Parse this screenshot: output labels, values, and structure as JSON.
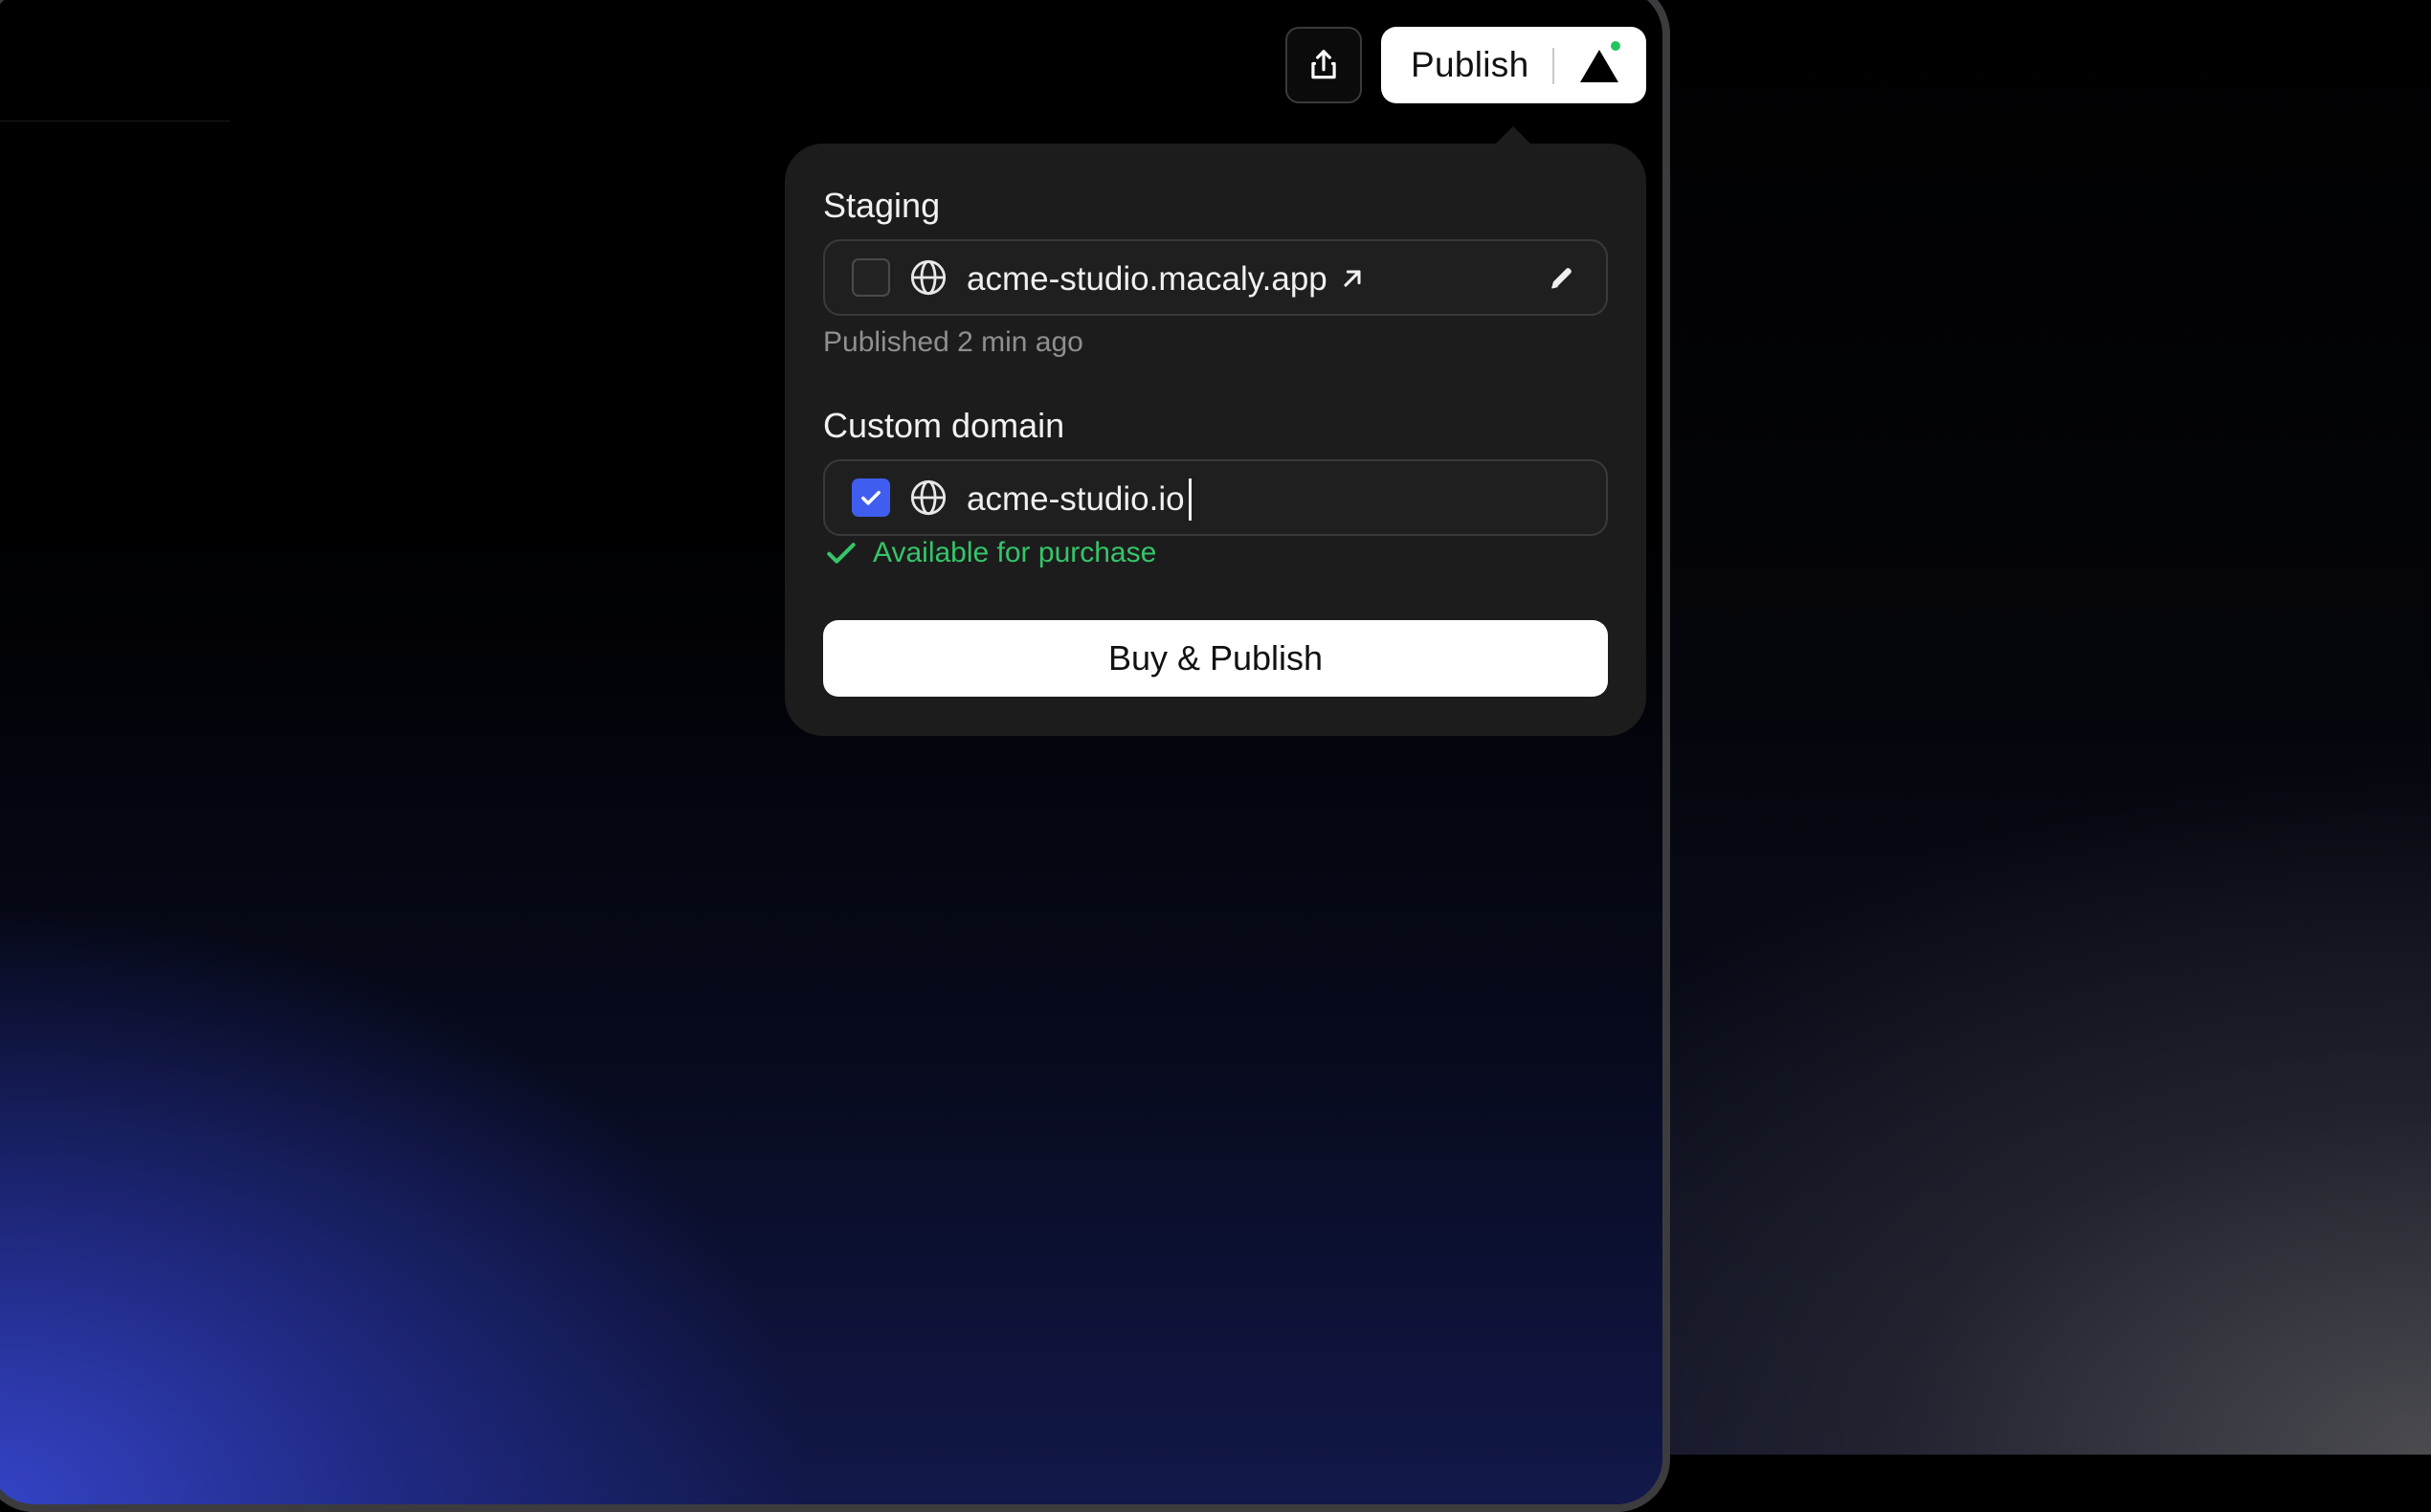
{
  "toolbar": {
    "share_icon": "share-icon",
    "publish_label": "Publish",
    "publish_logo_icon": "triangle-logo-icon",
    "status_dot_color": "#22c55e"
  },
  "popover": {
    "staging": {
      "label": "Staging",
      "checked": false,
      "icon": "globe-icon",
      "value": "acme-studio.macaly.app",
      "external_link_icon": "arrow-up-right-icon",
      "edit_icon": "pencil-icon",
      "status": "Published 2 min ago"
    },
    "custom_domain": {
      "label": "Custom domain",
      "checked": true,
      "icon": "globe-icon",
      "value": "acme-studio.io",
      "availability": "Available for purchase",
      "availability_color": "#35c56a"
    },
    "buy_button_label": "Buy & Publish"
  },
  "colors": {
    "accent": "#3f5ef0",
    "popover_bg": "#1c1c1c"
  }
}
